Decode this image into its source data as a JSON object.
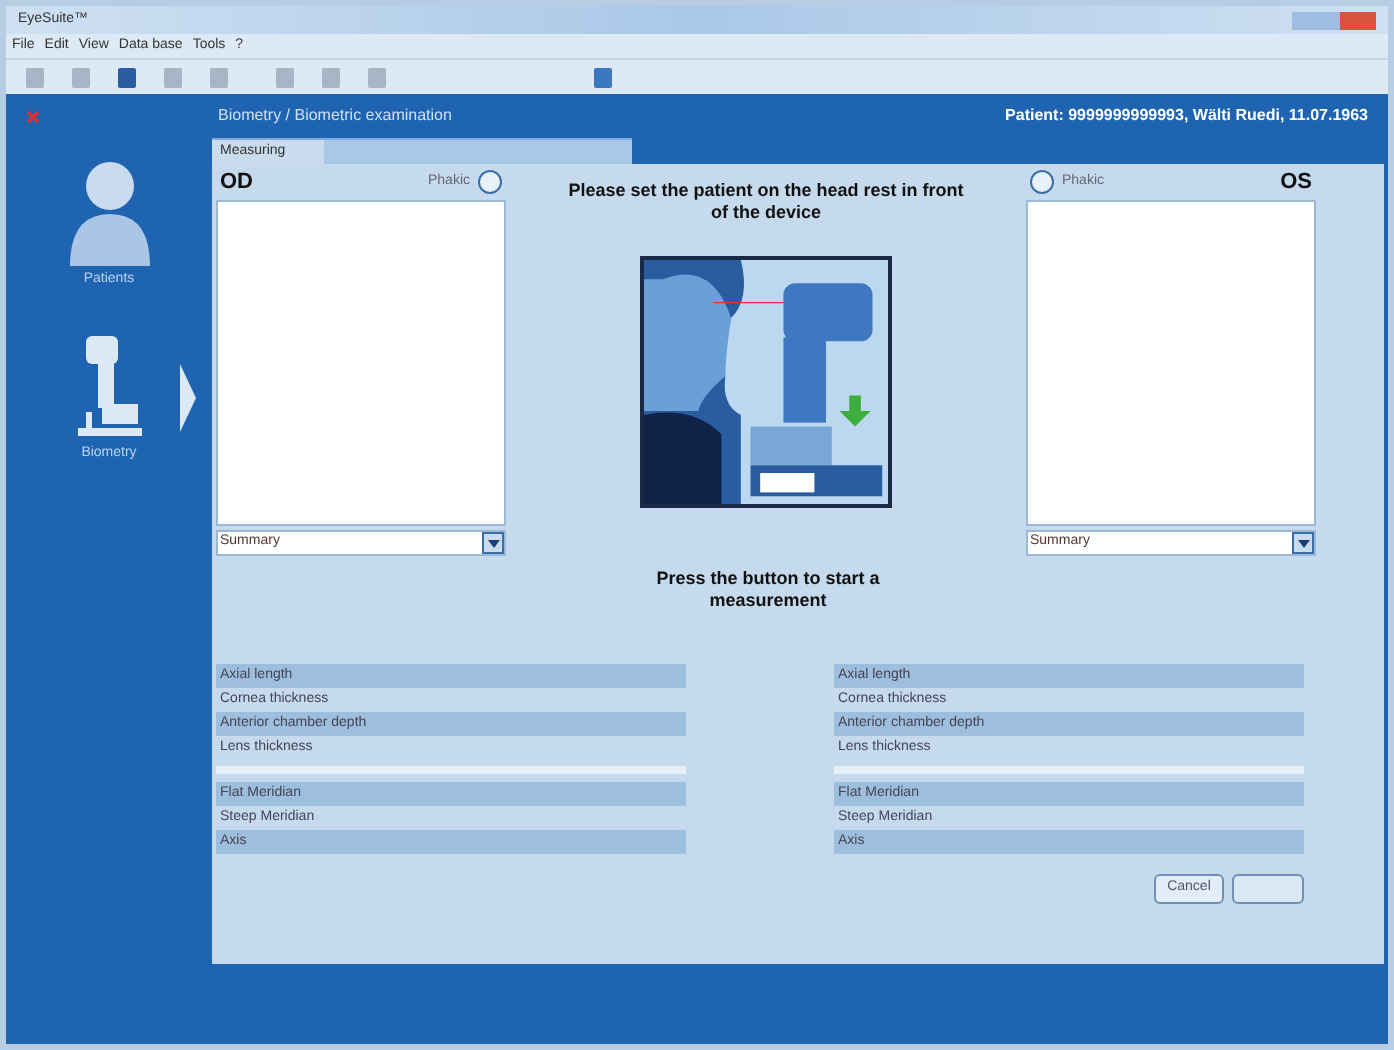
{
  "window": {
    "title": "EyeSuite™"
  },
  "menu": [
    "File",
    "Edit",
    "View",
    "Data base",
    "Tools",
    "?"
  ],
  "header": {
    "breadcrumb": "Biometry / Biometric examination",
    "patient": "Patient: 9999999999993, Wälti Ruedi, 11.07.1963"
  },
  "sidebar": {
    "items": [
      {
        "label": "Patients",
        "kind": "person",
        "selected": false
      },
      {
        "label": "Biometry",
        "kind": "device",
        "selected": true
      }
    ]
  },
  "tabs": [
    {
      "label": "Measuring",
      "selected": true
    },
    {
      "selected": false
    }
  ],
  "eyes": [
    {
      "label": "OD",
      "kind": "right",
      "phakic": {
        "label": "Phakic",
        "checked": false
      },
      "dropdown": "Summary"
    },
    {
      "label": "OS",
      "kind": "left",
      "phakic": {
        "label": "Phakic",
        "checked": false
      },
      "dropdown": "Summary"
    }
  ],
  "instructions": [
    "Please set the patient on the head rest in front of the device",
    "Press the button to start a measurement"
  ],
  "measurements": [
    {
      "groups": [
        [
          "Axial length",
          "Cornea thickness",
          "Anterior chamber depth",
          "Lens thickness"
        ],
        [
          "Flat Meridian",
          "Steep Meridian",
          "Axis"
        ]
      ]
    },
    {
      "groups": [
        [
          "Axial length",
          "Cornea thickness",
          "Anterior chamber depth",
          "Lens thickness"
        ],
        [
          "Flat Meridian",
          "Steep Meridian",
          "Axis"
        ]
      ]
    }
  ],
  "buttons": [
    {
      "kind": "cancel",
      "label": "Cancel"
    },
    {
      "kind": "blank"
    }
  ]
}
